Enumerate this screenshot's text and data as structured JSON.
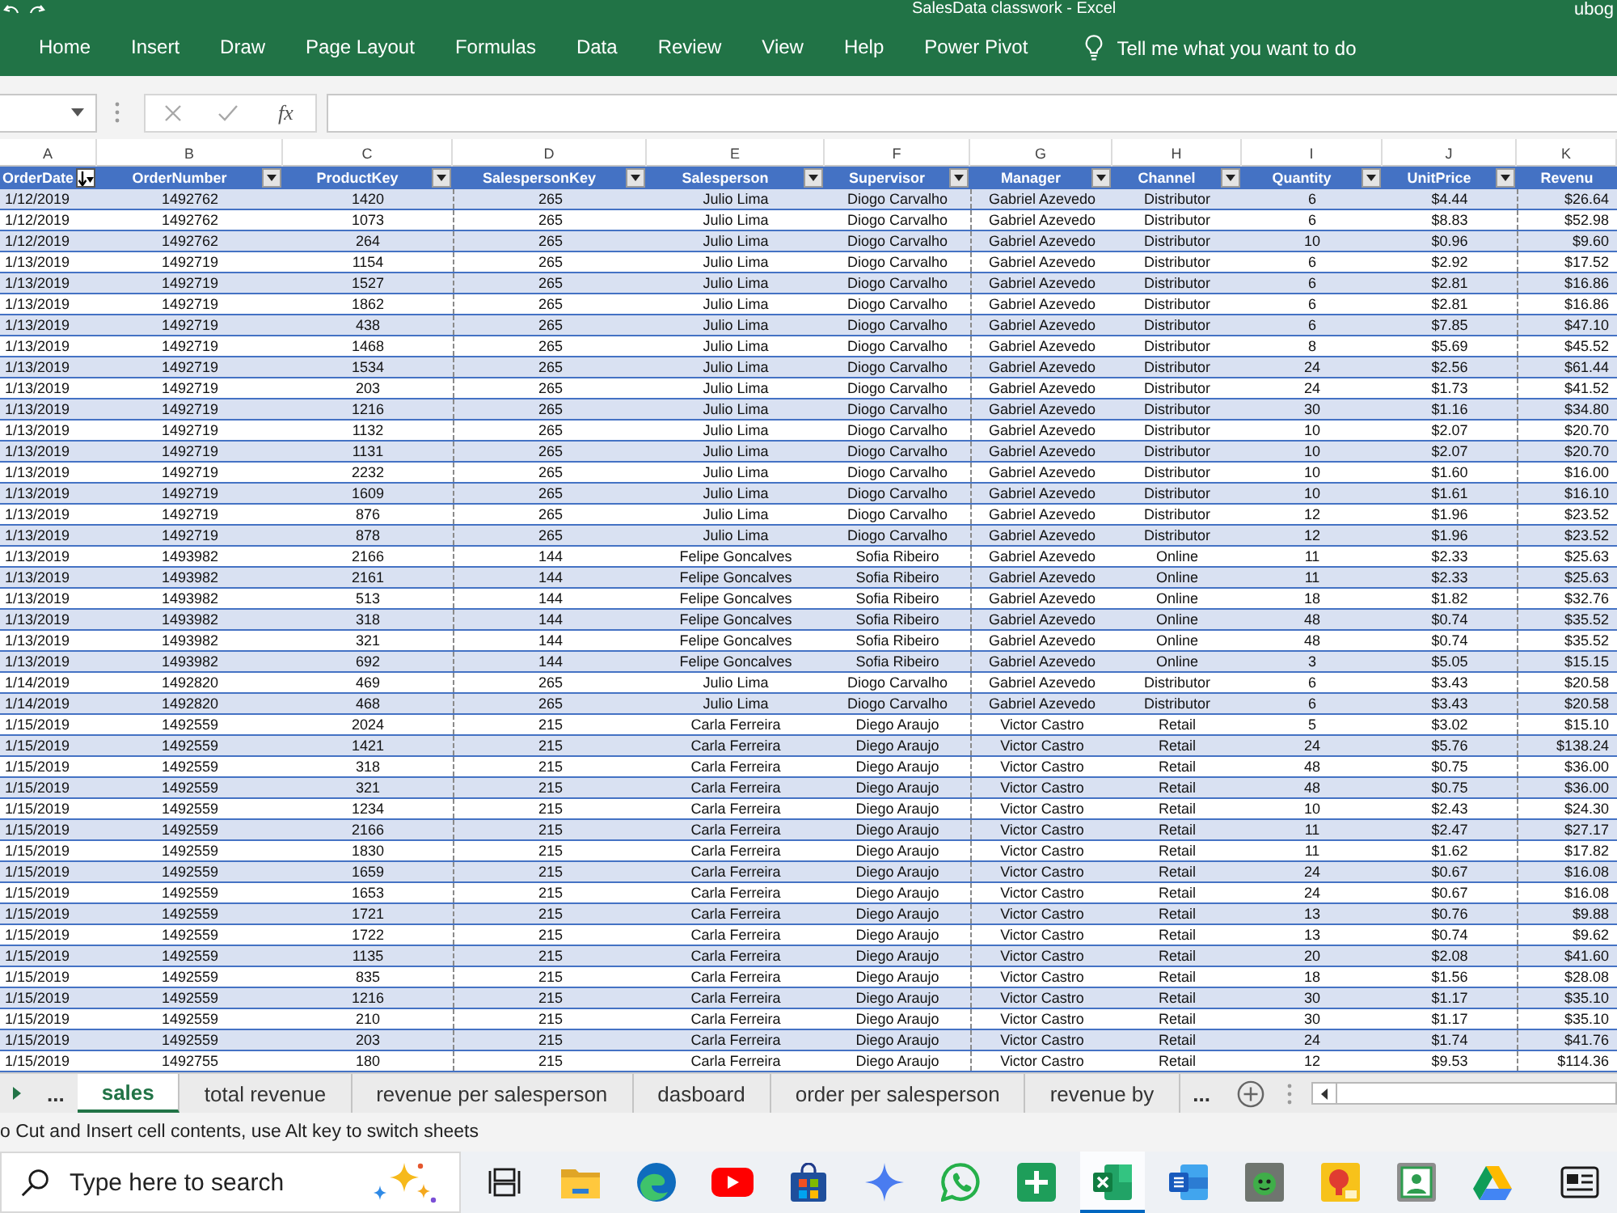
{
  "window": {
    "title": "SalesData classwork - Excel",
    "account": "ubog"
  },
  "ribbon": {
    "tabs": [
      {
        "label": "Home",
        "selected": false
      },
      {
        "label": "Insert",
        "selected": false
      },
      {
        "label": "Draw",
        "selected": false
      },
      {
        "label": "Page Layout",
        "selected": false
      },
      {
        "label": "Formulas",
        "selected": false
      },
      {
        "label": "Data",
        "selected": false
      },
      {
        "label": "Review",
        "selected": false
      },
      {
        "label": "View",
        "selected": false
      },
      {
        "label": "Help",
        "selected": false
      },
      {
        "label": "Power Pivot",
        "selected": false
      }
    ],
    "tell_me": "Tell me what you want to do"
  },
  "formula_bar": {
    "function_label": "fx",
    "edit_controls_disabled": true
  },
  "table": {
    "columns": [
      {
        "letter": "A",
        "label": "OrderDate",
        "filter_button": true,
        "sorted": true,
        "page_break": false
      },
      {
        "letter": "B",
        "label": "OrderNumber",
        "filter_button": true,
        "sorted": false,
        "page_break": false
      },
      {
        "letter": "C",
        "label": "ProductKey",
        "filter_button": true,
        "sorted": false,
        "page_break": false
      },
      {
        "letter": "D",
        "label": "SalespersonKey",
        "filter_button": true,
        "sorted": false,
        "page_break": true
      },
      {
        "letter": "E",
        "label": "Salesperson",
        "filter_button": true,
        "sorted": false,
        "page_break": false
      },
      {
        "letter": "F",
        "label": "Supervisor",
        "filter_button": true,
        "sorted": false,
        "page_break": false
      },
      {
        "letter": "G",
        "label": "Manager",
        "filter_button": true,
        "sorted": false,
        "page_break": true
      },
      {
        "letter": "H",
        "label": "Channel",
        "filter_button": true,
        "sorted": false,
        "page_break": false
      },
      {
        "letter": "I",
        "label": "Quantity",
        "filter_button": true,
        "sorted": false,
        "page_break": false
      },
      {
        "letter": "J",
        "label": "UnitPrice",
        "filter_button": true,
        "sorted": false,
        "page_break": false
      },
      {
        "letter": "K",
        "label": "Revenu",
        "filter_button": false,
        "sorted": false,
        "page_break": true
      }
    ],
    "rows": [
      [
        "1/12/2019",
        "1492762",
        "1420",
        "265",
        "Julio Lima",
        "Diogo Carvalho",
        "Gabriel Azevedo",
        "Distributor",
        "6",
        "$4.44",
        "$26.64"
      ],
      [
        "1/12/2019",
        "1492762",
        "1073",
        "265",
        "Julio Lima",
        "Diogo Carvalho",
        "Gabriel Azevedo",
        "Distributor",
        "6",
        "$8.83",
        "$52.98"
      ],
      [
        "1/12/2019",
        "1492762",
        "264",
        "265",
        "Julio Lima",
        "Diogo Carvalho",
        "Gabriel Azevedo",
        "Distributor",
        "10",
        "$0.96",
        "$9.60"
      ],
      [
        "1/13/2019",
        "1492719",
        "1154",
        "265",
        "Julio Lima",
        "Diogo Carvalho",
        "Gabriel Azevedo",
        "Distributor",
        "6",
        "$2.92",
        "$17.52"
      ],
      [
        "1/13/2019",
        "1492719",
        "1527",
        "265",
        "Julio Lima",
        "Diogo Carvalho",
        "Gabriel Azevedo",
        "Distributor",
        "6",
        "$2.81",
        "$16.86"
      ],
      [
        "1/13/2019",
        "1492719",
        "1862",
        "265",
        "Julio Lima",
        "Diogo Carvalho",
        "Gabriel Azevedo",
        "Distributor",
        "6",
        "$2.81",
        "$16.86"
      ],
      [
        "1/13/2019",
        "1492719",
        "438",
        "265",
        "Julio Lima",
        "Diogo Carvalho",
        "Gabriel Azevedo",
        "Distributor",
        "6",
        "$7.85",
        "$47.10"
      ],
      [
        "1/13/2019",
        "1492719",
        "1468",
        "265",
        "Julio Lima",
        "Diogo Carvalho",
        "Gabriel Azevedo",
        "Distributor",
        "8",
        "$5.69",
        "$45.52"
      ],
      [
        "1/13/2019",
        "1492719",
        "1534",
        "265",
        "Julio Lima",
        "Diogo Carvalho",
        "Gabriel Azevedo",
        "Distributor",
        "24",
        "$2.56",
        "$61.44"
      ],
      [
        "1/13/2019",
        "1492719",
        "203",
        "265",
        "Julio Lima",
        "Diogo Carvalho",
        "Gabriel Azevedo",
        "Distributor",
        "24",
        "$1.73",
        "$41.52"
      ],
      [
        "1/13/2019",
        "1492719",
        "1216",
        "265",
        "Julio Lima",
        "Diogo Carvalho",
        "Gabriel Azevedo",
        "Distributor",
        "30",
        "$1.16",
        "$34.80"
      ],
      [
        "1/13/2019",
        "1492719",
        "1132",
        "265",
        "Julio Lima",
        "Diogo Carvalho",
        "Gabriel Azevedo",
        "Distributor",
        "10",
        "$2.07",
        "$20.70"
      ],
      [
        "1/13/2019",
        "1492719",
        "1131",
        "265",
        "Julio Lima",
        "Diogo Carvalho",
        "Gabriel Azevedo",
        "Distributor",
        "10",
        "$2.07",
        "$20.70"
      ],
      [
        "1/13/2019",
        "1492719",
        "2232",
        "265",
        "Julio Lima",
        "Diogo Carvalho",
        "Gabriel Azevedo",
        "Distributor",
        "10",
        "$1.60",
        "$16.00"
      ],
      [
        "1/13/2019",
        "1492719",
        "1609",
        "265",
        "Julio Lima",
        "Diogo Carvalho",
        "Gabriel Azevedo",
        "Distributor",
        "10",
        "$1.61",
        "$16.10"
      ],
      [
        "1/13/2019",
        "1492719",
        "876",
        "265",
        "Julio Lima",
        "Diogo Carvalho",
        "Gabriel Azevedo",
        "Distributor",
        "12",
        "$1.96",
        "$23.52"
      ],
      [
        "1/13/2019",
        "1492719",
        "878",
        "265",
        "Julio Lima",
        "Diogo Carvalho",
        "Gabriel Azevedo",
        "Distributor",
        "12",
        "$1.96",
        "$23.52"
      ],
      [
        "1/13/2019",
        "1493982",
        "2166",
        "144",
        "Felipe Goncalves",
        "Sofia Ribeiro",
        "Gabriel Azevedo",
        "Online",
        "11",
        "$2.33",
        "$25.63"
      ],
      [
        "1/13/2019",
        "1493982",
        "2161",
        "144",
        "Felipe Goncalves",
        "Sofia Ribeiro",
        "Gabriel Azevedo",
        "Online",
        "11",
        "$2.33",
        "$25.63"
      ],
      [
        "1/13/2019",
        "1493982",
        "513",
        "144",
        "Felipe Goncalves",
        "Sofia Ribeiro",
        "Gabriel Azevedo",
        "Online",
        "18",
        "$1.82",
        "$32.76"
      ],
      [
        "1/13/2019",
        "1493982",
        "318",
        "144",
        "Felipe Goncalves",
        "Sofia Ribeiro",
        "Gabriel Azevedo",
        "Online",
        "48",
        "$0.74",
        "$35.52"
      ],
      [
        "1/13/2019",
        "1493982",
        "321",
        "144",
        "Felipe Goncalves",
        "Sofia Ribeiro",
        "Gabriel Azevedo",
        "Online",
        "48",
        "$0.74",
        "$35.52"
      ],
      [
        "1/13/2019",
        "1493982",
        "692",
        "144",
        "Felipe Goncalves",
        "Sofia Ribeiro",
        "Gabriel Azevedo",
        "Online",
        "3",
        "$5.05",
        "$15.15"
      ],
      [
        "1/14/2019",
        "1492820",
        "469",
        "265",
        "Julio Lima",
        "Diogo Carvalho",
        "Gabriel Azevedo",
        "Distributor",
        "6",
        "$3.43",
        "$20.58"
      ],
      [
        "1/14/2019",
        "1492820",
        "468",
        "265",
        "Julio Lima",
        "Diogo Carvalho",
        "Gabriel Azevedo",
        "Distributor",
        "6",
        "$3.43",
        "$20.58"
      ],
      [
        "1/15/2019",
        "1492559",
        "2024",
        "215",
        "Carla Ferreira",
        "Diego Araujo",
        "Victor Castro",
        "Retail",
        "5",
        "$3.02",
        "$15.10"
      ],
      [
        "1/15/2019",
        "1492559",
        "1421",
        "215",
        "Carla Ferreira",
        "Diego Araujo",
        "Victor Castro",
        "Retail",
        "24",
        "$5.76",
        "$138.24"
      ],
      [
        "1/15/2019",
        "1492559",
        "318",
        "215",
        "Carla Ferreira",
        "Diego Araujo",
        "Victor Castro",
        "Retail",
        "48",
        "$0.75",
        "$36.00"
      ],
      [
        "1/15/2019",
        "1492559",
        "321",
        "215",
        "Carla Ferreira",
        "Diego Araujo",
        "Victor Castro",
        "Retail",
        "48",
        "$0.75",
        "$36.00"
      ],
      [
        "1/15/2019",
        "1492559",
        "1234",
        "215",
        "Carla Ferreira",
        "Diego Araujo",
        "Victor Castro",
        "Retail",
        "10",
        "$2.43",
        "$24.30"
      ],
      [
        "1/15/2019",
        "1492559",
        "2166",
        "215",
        "Carla Ferreira",
        "Diego Araujo",
        "Victor Castro",
        "Retail",
        "11",
        "$2.47",
        "$27.17"
      ],
      [
        "1/15/2019",
        "1492559",
        "1830",
        "215",
        "Carla Ferreira",
        "Diego Araujo",
        "Victor Castro",
        "Retail",
        "11",
        "$1.62",
        "$17.82"
      ],
      [
        "1/15/2019",
        "1492559",
        "1659",
        "215",
        "Carla Ferreira",
        "Diego Araujo",
        "Victor Castro",
        "Retail",
        "24",
        "$0.67",
        "$16.08"
      ],
      [
        "1/15/2019",
        "1492559",
        "1653",
        "215",
        "Carla Ferreira",
        "Diego Araujo",
        "Victor Castro",
        "Retail",
        "24",
        "$0.67",
        "$16.08"
      ],
      [
        "1/15/2019",
        "1492559",
        "1721",
        "215",
        "Carla Ferreira",
        "Diego Araujo",
        "Victor Castro",
        "Retail",
        "13",
        "$0.76",
        "$9.88"
      ],
      [
        "1/15/2019",
        "1492559",
        "1722",
        "215",
        "Carla Ferreira",
        "Diego Araujo",
        "Victor Castro",
        "Retail",
        "13",
        "$0.74",
        "$9.62"
      ],
      [
        "1/15/2019",
        "1492559",
        "1135",
        "215",
        "Carla Ferreira",
        "Diego Araujo",
        "Victor Castro",
        "Retail",
        "20",
        "$2.08",
        "$41.60"
      ],
      [
        "1/15/2019",
        "1492559",
        "835",
        "215",
        "Carla Ferreira",
        "Diego Araujo",
        "Victor Castro",
        "Retail",
        "18",
        "$1.56",
        "$28.08"
      ],
      [
        "1/15/2019",
        "1492559",
        "1216",
        "215",
        "Carla Ferreira",
        "Diego Araujo",
        "Victor Castro",
        "Retail",
        "30",
        "$1.17",
        "$35.10"
      ],
      [
        "1/15/2019",
        "1492559",
        "210",
        "215",
        "Carla Ferreira",
        "Diego Araujo",
        "Victor Castro",
        "Retail",
        "30",
        "$1.17",
        "$35.10"
      ],
      [
        "1/15/2019",
        "1492559",
        "203",
        "215",
        "Carla Ferreira",
        "Diego Araujo",
        "Victor Castro",
        "Retail",
        "24",
        "$1.74",
        "$41.76"
      ],
      [
        "1/15/2019",
        "1492755",
        "180",
        "215",
        "Carla Ferreira",
        "Diego Araujo",
        "Victor Castro",
        "Retail",
        "12",
        "$9.53",
        "$114.36"
      ]
    ]
  },
  "sheet_bar": {
    "left_overflow": "...",
    "tabs": [
      {
        "label": "sales",
        "selected": true
      },
      {
        "label": "total revenue",
        "selected": false
      },
      {
        "label": "revenue per salesperson",
        "selected": false
      },
      {
        "label": "dasboard",
        "selected": false
      },
      {
        "label": "order per salesperson",
        "selected": false
      },
      {
        "label": "revenue by",
        "selected": false
      }
    ],
    "right_overflow": "..."
  },
  "status_bar": {
    "message": "o Cut and Insert cell contents, use Alt key to switch sheets"
  },
  "taskbar": {
    "search_placeholder": "Type here to search",
    "apps": [
      {
        "kind": "task_view",
        "active": false
      },
      {
        "kind": "folder",
        "active": false
      },
      {
        "kind": "browser",
        "active": false
      },
      {
        "kind": "video",
        "active": false
      },
      {
        "kind": "store",
        "active": false
      },
      {
        "kind": "assistant",
        "active": false
      },
      {
        "kind": "chat",
        "active": false
      },
      {
        "kind": "plus_tile",
        "active": false
      },
      {
        "kind": "spreadsheet",
        "active": true
      },
      {
        "kind": "document",
        "active": false
      },
      {
        "kind": "game",
        "active": false
      },
      {
        "kind": "bulb_tile",
        "active": false
      },
      {
        "kind": "person_tile",
        "active": false
      },
      {
        "kind": "drive",
        "active": false
      },
      {
        "kind": "news",
        "active": false
      }
    ]
  }
}
